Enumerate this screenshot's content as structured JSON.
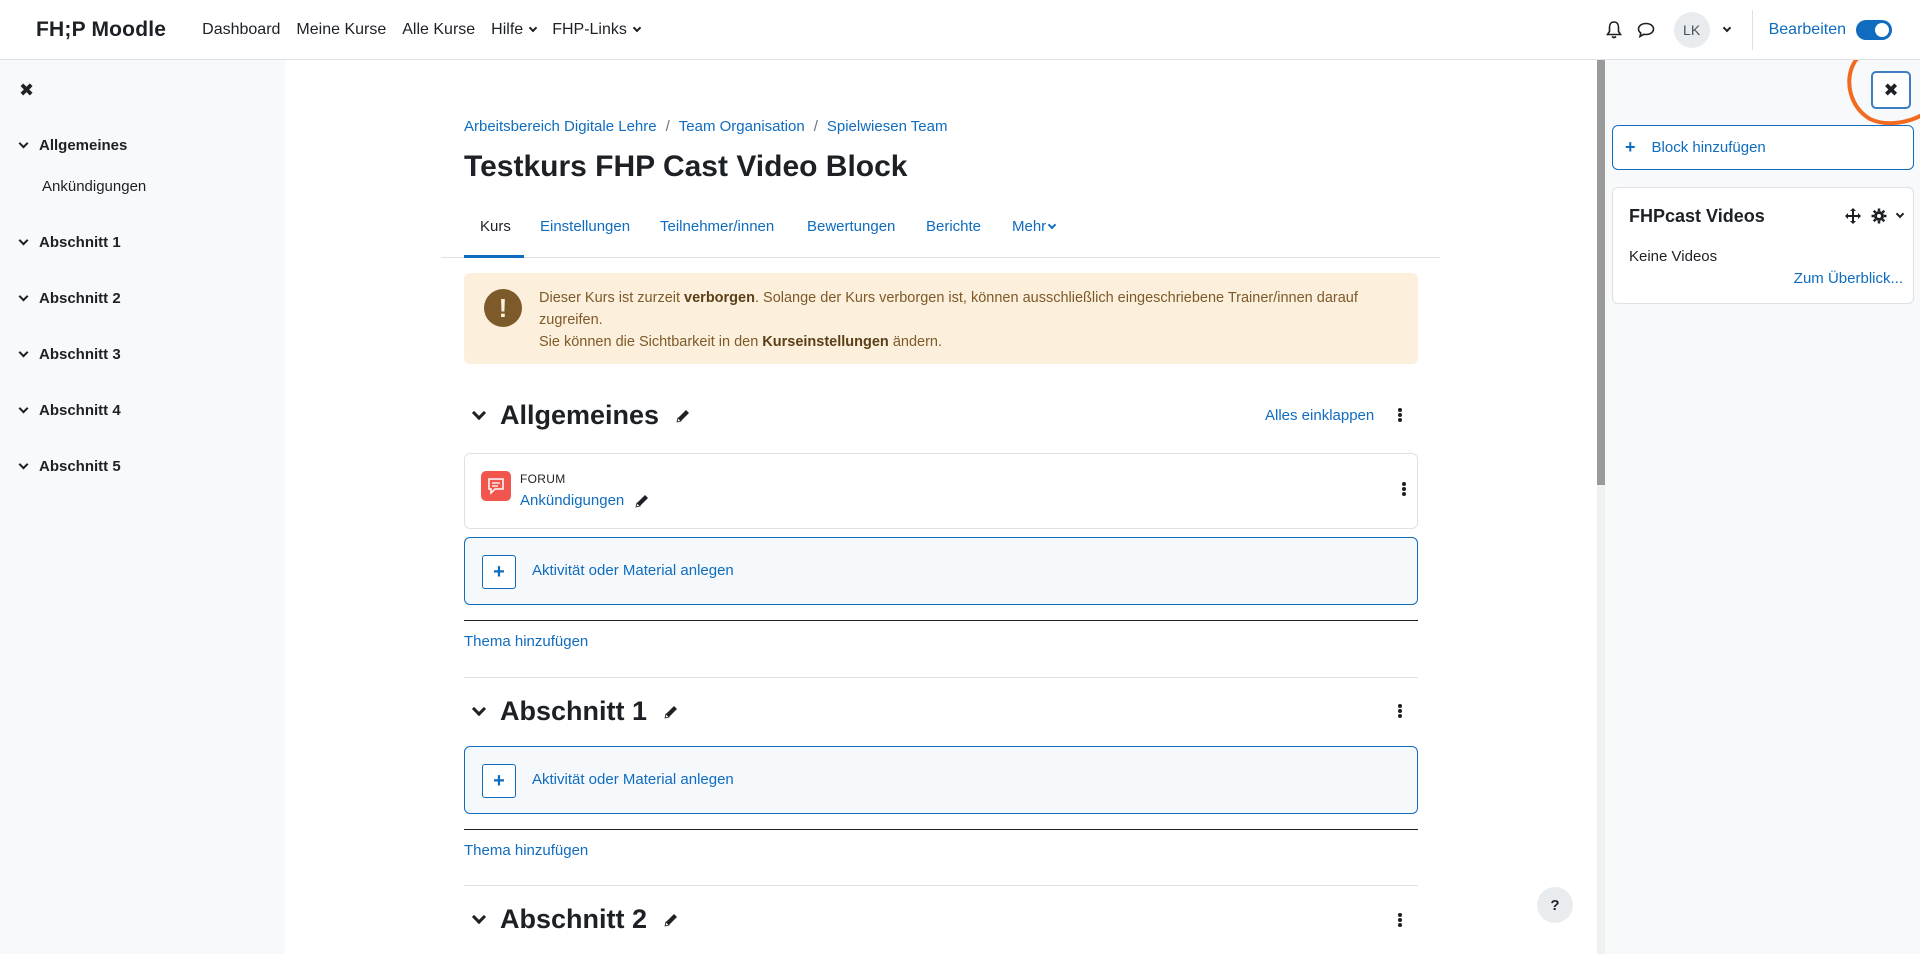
{
  "navbar": {
    "brand": "FH;P Moodle",
    "links": [
      "Dashboard",
      "Meine Kurse",
      "Alle Kurse",
      "Hilfe",
      "FHP-Links"
    ],
    "avatar_initials": "LK",
    "edit_label": "Bearbeiten"
  },
  "left_drawer": {
    "sections": [
      {
        "label": "Allgemeines",
        "items": [
          "Ankündigungen"
        ]
      },
      {
        "label": "Abschnitt 1"
      },
      {
        "label": "Abschnitt 2"
      },
      {
        "label": "Abschnitt 3"
      },
      {
        "label": "Abschnitt 4"
      },
      {
        "label": "Abschnitt 5"
      }
    ]
  },
  "breadcrumb": [
    "Arbeitsbereich Digitale Lehre",
    "Team Organisation",
    "Spielwiesen Team"
  ],
  "page_title": "Testkurs FHP Cast Video Block",
  "tabs": [
    "Kurs",
    "Einstellungen",
    "Teilnehmer/innen",
    "Bewertungen",
    "Berichte",
    "Mehr"
  ],
  "alert": {
    "part1": "Dieser Kurs ist zurzeit ",
    "bold1": "verborgen",
    "part2": ". Solange der Kurs verborgen ist, können ausschließlich eingeschriebene Trainer/innen darauf zugreifen.",
    "part3": "Sie können die Sichtbarkeit in den ",
    "bold2": "Kurseinstellungen",
    "part4": " ändern."
  },
  "sections": {
    "general": "Allgemeines",
    "collapse_all": "Alles einklappen",
    "forum_type": "FORUM",
    "forum_name": "Ankündigungen",
    "add_activity": "Aktivität oder Material anlegen",
    "add_topic": "Thema hinzufügen",
    "s1": "Abschnitt 1",
    "s2": "Abschnitt 2"
  },
  "right_drawer": {
    "add_block": "Block hinzufügen",
    "block_title": "FHPcast Videos",
    "block_empty": "Keine Videos",
    "block_link": "Zum Überblick..."
  },
  "colors": {
    "accent": "#0f6cbf",
    "alert_bg": "#fcefdc",
    "forum": "#f0564e",
    "annotation": "#f26a1f"
  },
  "help": "?"
}
